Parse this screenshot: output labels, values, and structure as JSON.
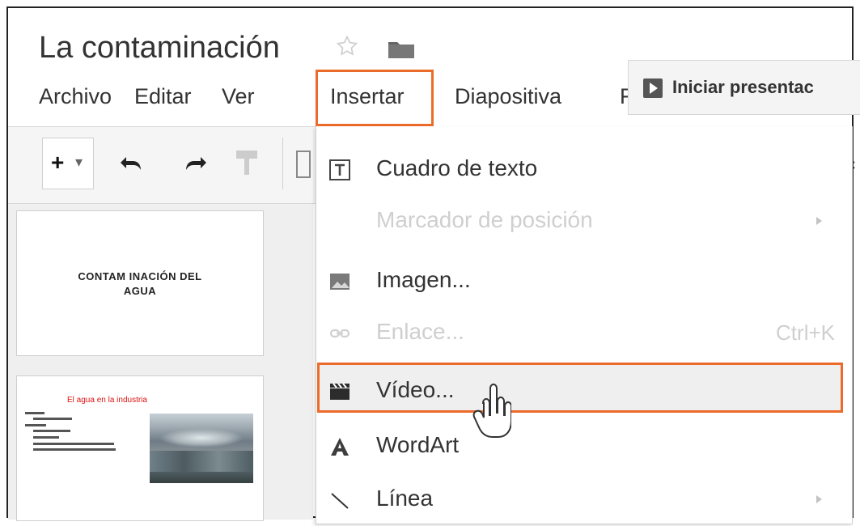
{
  "document": {
    "title": "La contaminación"
  },
  "header": {
    "star_icon": "star-outline-icon",
    "folder_icon": "folder-icon",
    "menubar": [
      "Archivo",
      "Editar",
      "Ver",
      "Insertar",
      "Diapositiva",
      "F"
    ],
    "highlighted_menu": "Insertar"
  },
  "present": {
    "label": "Iniciar presentac"
  },
  "toolbar": {
    "add_label": "+",
    "add_arrow": "▾",
    "right_text": "ıc"
  },
  "slides": [
    {
      "title": "CONTAM INACIÓN DEL\nAGUA"
    },
    {
      "title": "El agua en la industria"
    }
  ],
  "insert_menu": {
    "items": [
      {
        "label": "Cuadro de texto",
        "icon": "text-box-icon",
        "enabled": true
      },
      {
        "label": "Marcador de posición",
        "enabled": false,
        "submenu": true
      },
      {
        "label": "Imagen...",
        "icon": "image-icon",
        "enabled": true
      },
      {
        "label": "Enlace...",
        "icon": "link-icon",
        "enabled": false,
        "shortcut": "Ctrl+K"
      },
      {
        "label": "Vídeo...",
        "icon": "video-icon",
        "enabled": true,
        "highlighted": true
      },
      {
        "label": "WordArt",
        "icon": "wordart-icon",
        "enabled": true
      },
      {
        "label": "Línea",
        "icon": "line-icon",
        "enabled": true,
        "submenu": true
      }
    ]
  },
  "colors": {
    "highlight_border": "#ec6b2a",
    "disabled_text": "#cfcfcf",
    "text": "#333333"
  }
}
